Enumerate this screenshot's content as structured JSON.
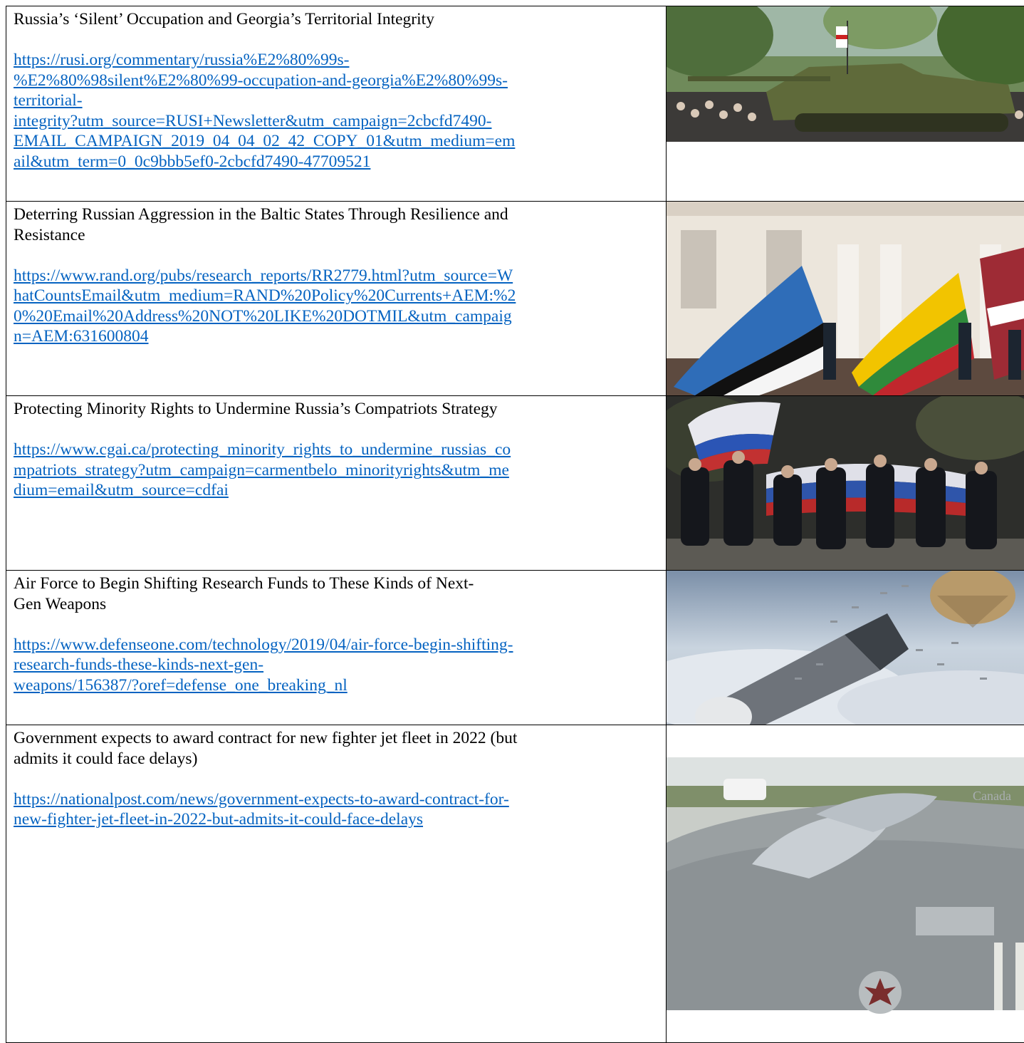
{
  "articles": [
    {
      "title": "Russia’s ‘Silent’ Occupation and Georgia’s Territorial Integrity",
      "url_lines": [
        "https://rusi.org/commentary/russia%E2%80%99s-",
        "%E2%80%98silent%E2%80%99-occupation-and-georgia%E2%80%99s-",
        "territorial-",
        "integrity?utm_source=RUSI+Newsletter&utm_campaign=2cbcfd7490-",
        "EMAIL_CAMPAIGN_2019_04_04_02_42_COPY_01&utm_medium=em",
        "ail&utm_term=0_0c9bbb5ef0-2cbcfd7490-47709521"
      ],
      "image": "military-parade-tank-photo"
    },
    {
      "title_lines": [
        "Deterring Russian Aggression in the Baltic States Through Resilience and",
        "Resistance"
      ],
      "url_lines": [
        "https://www.rand.org/pubs/research_reports/RR2779.html?utm_source=W",
        "hatCountsEmail&utm_medium=RAND%20Policy%20Currents+AEM:%2",
        "0%20Email%20Address%20NOT%20LIKE%20DOTMIL&utm_campaig",
        "n=AEM:631600804"
      ],
      "image": "baltic-flags-ceremony-photo"
    },
    {
      "title": "Protecting Minority Rights to Undermine Russia’s Compatriots Strategy",
      "url_lines": [
        "https://www.cgai.ca/protecting_minority_rights_to_undermine_russias_co",
        "mpatriots_strategy?utm_campaign=carmentbelo_minorityrights&utm_me",
        "dium=email&utm_source=cdfai"
      ],
      "image": "crowd-with-russian-flag-photo"
    },
    {
      "title_lines": [
        "Air Force to Begin Shifting Research Funds to These Kinds of Next-",
        "Gen Weapons"
      ],
      "url_lines": [
        "https://www.defenseone.com/technology/2019/04/air-force-begin-shifting-",
        "research-funds-these-kinds-next-gen-",
        "weapons/156387/?oref=defense_one_breaking_nl"
      ],
      "image": "missile-drone-swarm-render"
    },
    {
      "title_lines": [
        "Government expects to award contract for new fighter jet fleet in 2022 (but",
        "admits it could face delays)"
      ],
      "url_lines": [
        "https://nationalpost.com/news/government-expects-to-award-contract-for-",
        "new-fighter-jet-fleet-in-2022-but-admits-it-could-face-delays"
      ],
      "image": "fighter-jets-cockpit-photo",
      "image_text": "Canada"
    }
  ]
}
